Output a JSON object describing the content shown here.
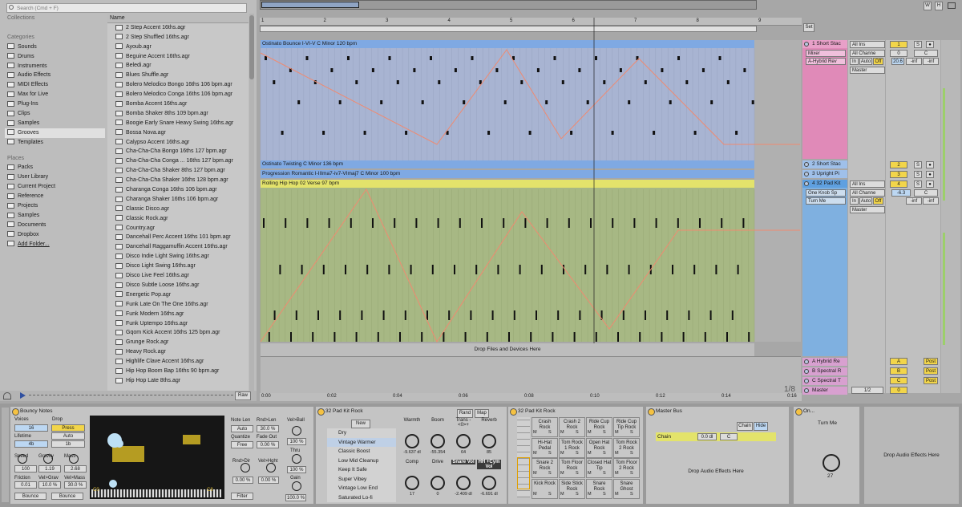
{
  "browser": {
    "search_placeholder": "Search (Cmd + F)",
    "collections_header": "Collections",
    "categories_header": "Categories",
    "categories": [
      "Sounds",
      "Drums",
      "Instruments",
      "Audio Effects",
      "MIDI Effects",
      "Max for Live",
      "Plug-Ins",
      "Clips",
      "Samples",
      "Grooves",
      "Templates"
    ],
    "selected_category": "Grooves",
    "places_header": "Places",
    "places": [
      "Packs",
      "User Library",
      "Current Project",
      "Reference",
      "Projects",
      "Samples",
      "Documents",
      "Dropbox",
      "Add Folder..."
    ],
    "name_header": "Name",
    "files": [
      "2 Step Accent 16ths.agr",
      "2 Step Shuffled 16ths.agr",
      "Ayoub.agr",
      "Beguine Accent 16ths.agr",
      "Beledi.agr",
      "Blues Shuffle.agr",
      "Bolero Melodico Bongo 16ths 106 bpm.agr",
      "Bolero Melodico Conga 16ths 106 bpm.agr",
      "Bomba Accent 16ths.agr",
      "Bomba Shaker 8ths 109 bpm.agr",
      "Boogie Early Snare Heavy Swing 16ths.agr",
      "Bossa Nova.agr",
      "Calypso Accent 16ths.agr",
      "Cha-Cha-Cha Bongo 16ths 127 bpm.agr",
      "Cha-Cha-Cha Conga ... 16ths 127 bpm.agr",
      "Cha-Cha-Cha Shaker 8ths 127 bpm.agr",
      "Cha-Cha-Cha Shaker 16ths 128 bpm.agr",
      "Charanga Conga 16ths 106 bpm.agr",
      "Charanga Shaker 16ths 106 bpm.agr",
      "Classic Disco.agr",
      "Classic Rock.agr",
      "Country.agr",
      "Dancehall Perc Accent 16ths 101 bpm.agr",
      "Dancehall Raggamuffin Accent 16ths.agr",
      "Disco Indie Light Swing 16ths.agr",
      "Disco Light Swing 16ths.agr",
      "Disco Live Feel 16ths.agr",
      "Disco Subtle Loose 16ths.agr",
      "Energetic Pop.agr",
      "Funk Late On The One 16ths.agr",
      "Funk Modern 16ths.agr",
      "Funk Uptempo 16ths.agr",
      "Gqom Kick Accent 16ths 125 bpm.agr",
      "Grunge Rock.agr",
      "Heavy Rock.agr",
      "Highlife Clave Accent 16ths.agr",
      "Hip Hop Boom Bap 16ths 90 bpm.agr",
      "Hip Hop Late 8ths.agr"
    ],
    "raw_label": "Raw"
  },
  "arrangement": {
    "bar_numbers": [
      "1",
      "2",
      "3",
      "4",
      "5",
      "6",
      "7",
      "8",
      "9"
    ],
    "time_labels": [
      "0:00",
      "0:02",
      "0:04",
      "0:06",
      "0:08",
      "0:10",
      "0:12",
      "0:14",
      "0:16"
    ],
    "page_indicator": "1/8",
    "set_button": "Set",
    "drop_text": "Drop Files and Devices Here",
    "clips": [
      {
        "name": "Ostinato Bounce I-VI-V C Minor 120 bpm",
        "color": "#7fa9e3"
      },
      {
        "name": "Ostinato Twisting C Minor 136 bpm",
        "color": "#7fa9e3"
      },
      {
        "name": "Progression Romantic I-IIIma7-iv7-VImaj7 C Minor 100 bpm",
        "color": "#7fa9e3"
      },
      {
        "name": "Rolling Hip Hop 02 Verse 97 bpm",
        "color": "#e3e36b"
      }
    ]
  },
  "tracks": [
    {
      "name": "1 Short Stac",
      "color": "#e08ab8",
      "num": "1",
      "input": "All Ins",
      "channel": "Mixer",
      "device": "A-Hybrid Rev",
      "output": "Master",
      "vol": "20.6",
      "pan": "C",
      "inf1": "-inf",
      "inf2": "-inf",
      "val": "0"
    },
    {
      "name": "2 Short Stac",
      "num": "2"
    },
    {
      "name": "3 Upright Pi",
      "num": "3"
    },
    {
      "name": "4 32 Pad Kit",
      "color": "#7fb0e0",
      "num": "4",
      "input": "All Ins",
      "channel": "One Knob Sp",
      "device": "Turn Me",
      "output": "Master",
      "vol": "-6.3",
      "pan": "C",
      "inf1": "-inf",
      "inf2": "-inf"
    }
  ],
  "track_io_labels": {
    "all_channels": "All Channe",
    "in": "In",
    "auto": "Auto",
    "off": "Off"
  },
  "returns": [
    {
      "name": "A Hybrid Re",
      "letter": "A",
      "post": "Post"
    },
    {
      "name": "B Spectral R",
      "letter": "B",
      "post": "Post"
    },
    {
      "name": "C Spectral T",
      "letter": "C",
      "post": "Post"
    },
    {
      "name": "Master",
      "letter": "0",
      "extra": "1/2"
    }
  ],
  "devices": {
    "bouncy": {
      "title": "Bouncy Notes",
      "voices_label": "Voices",
      "voices": "16",
      "drop_label": "Drop",
      "drop": "Press",
      "auto": "Auto",
      "lifetime_label": "Lifetime",
      "lifetime": "4b",
      "lifetime_val": "1b",
      "speed_label": "Speed",
      "speed": "100",
      "gravity_label": "Gravity",
      "gravity": "1.19",
      "mass_label": "Mass",
      "mass": "2.68",
      "friction_label": "Friction",
      "friction": "0.01",
      "velgrav_label": "Vel>Grav",
      "velgrav": "10.0 %",
      "velmass_label": "Vel>Mass",
      "velmass": "30.0 %",
      "bounce1": "Bounce",
      "bounce2": "Bounce",
      "c0": "C0",
      "c8": "C8",
      "note_len_label": "Note Len",
      "note_len": "Auto",
      "rnd_len_label": "Rnd>Len",
      "rnd_len": "30.0 %",
      "quantize_label": "Quantize",
      "quantize": "Free",
      "fade_label": "Fade Out",
      "fade": "0.00 %",
      "rnd_dir_label": "Rnd>Dir",
      "rnd_dir": "0.00 %",
      "vel_hght_label": "Vel>Hght",
      "vel_hght": "0.00 %",
      "filter": "Filter",
      "vel_ball_label": "Vel>Ball",
      "vel_ball": "100 %",
      "thru_label": "Thru",
      "thru": "100 %",
      "gain_label": "Gain",
      "gain": "100.0 %"
    },
    "rack": {
      "title": "32 Pad Kit Rock",
      "new": "New",
      "rand": "Rand",
      "map": "Map",
      "chains": [
        "Dry",
        "Vintage Warmer",
        "Classic Boost",
        "Low Mid Cleanup",
        "Keep It Safe",
        "Super Vibey",
        "Vintage Low End",
        "Saturated Lo-fi"
      ],
      "macros": [
        {
          "name": "Warmth",
          "val": "-9.637 dl"
        },
        {
          "name": "Boom",
          "val": "-55.354"
        },
        {
          "name": "Trans -<0>+",
          "val": "64"
        },
        {
          "name": "Reverb",
          "val": "85"
        },
        {
          "name": "Comp",
          "val": "17"
        },
        {
          "name": "Drive",
          "val": "0"
        },
        {
          "name": "Snare Vol",
          "val": "-2.409 dl"
        },
        {
          "name": "HH +Cym Vol",
          "val": "-6.691 dl"
        }
      ]
    },
    "pads": {
      "title": "32 Pad Kit Rock",
      "pads": [
        "Crash Rock",
        "Crash 2 Rock",
        "Ride Cup Rock",
        "Ride Cup Tip Rock",
        "Hi-Hat Pedal",
        "Tom Rock 1 Rock",
        "Open Hat Rock",
        "Tom Rock 2 Rock",
        "Snare 2 Rock",
        "Tom Floor Rock",
        "Closed Hat Tip",
        "Tom Floor 2 Rock",
        "Kick Rock",
        "Side Stick Rock",
        "Snare Rock",
        "Snare Ghost"
      ],
      "m": "M",
      "s": "S"
    },
    "master_bus": {
      "title": "Master Bus",
      "chain": "Chain",
      "hide": "Hide",
      "chain_name": "Chain",
      "db": "0.0 dl",
      "pan": "C",
      "drop": "Drop Audio Effects Here"
    },
    "one_knob": {
      "title": "On...",
      "label": "Turn Me",
      "value": "27"
    },
    "drop_fx": "Drop Audio Effects Here"
  },
  "transport": {
    "w": "W",
    "h": "H"
  }
}
